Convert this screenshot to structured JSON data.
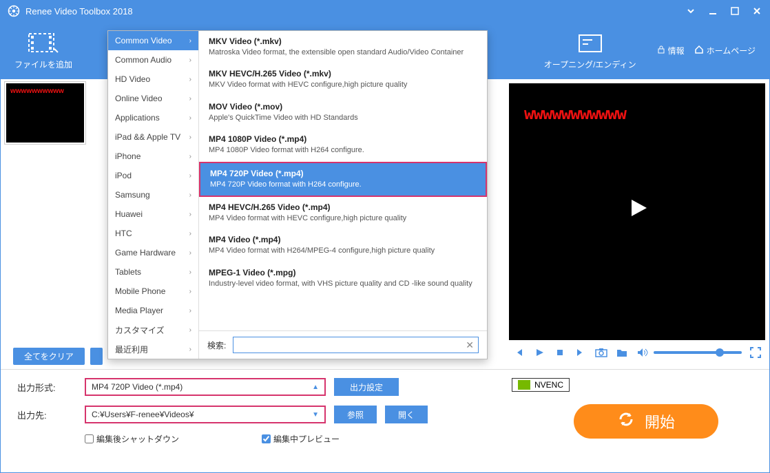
{
  "title": "Renee Video Toolbox 2018",
  "toolbar": {
    "add_file": "ファイルを追加",
    "opening_ending": "オープニング/エンディン",
    "info": "情報",
    "homepage": "ホームページ"
  },
  "preview": {
    "overlay_text": "wwwwwwwwwww",
    "thumb_text": "wwwwwwwwww"
  },
  "left_buttons": {
    "clear_all": "全てをクリア"
  },
  "dropdown": {
    "categories": [
      "Common Video",
      "Common Audio",
      "HD Video",
      "Online Video",
      "Applications",
      "iPad && Apple TV",
      "iPhone",
      "iPod",
      "Samsung",
      "Huawei",
      "HTC",
      "Game Hardware",
      "Tablets",
      "Mobile Phone",
      "Media Player",
      "カスタマイズ",
      "最近利用"
    ],
    "active_category": 0,
    "items": [
      {
        "title": "MKV Video (*.mkv)",
        "desc": "Matroska Video format, the extensible open standard Audio/Video Container"
      },
      {
        "title": "MKV HEVC/H.265 Video (*.mkv)",
        "desc": "MKV Video format with HEVC configure,high picture quality"
      },
      {
        "title": "MOV Video (*.mov)",
        "desc": "Apple's QuickTime Video with HD Standards"
      },
      {
        "title": "MP4 1080P Video (*.mp4)",
        "desc": "MP4 1080P Video format with H264 configure."
      },
      {
        "title": "MP4 720P Video (*.mp4)",
        "desc": "MP4 720P Video format with H264 configure."
      },
      {
        "title": "MP4 HEVC/H.265 Video (*.mp4)",
        "desc": "MP4 Video format with HEVC configure,high picture quality"
      },
      {
        "title": "MP4 Video (*.mp4)",
        "desc": "MP4 Video format with H264/MPEG-4 configure,high picture quality"
      },
      {
        "title": "MPEG-1 Video (*.mpg)",
        "desc": "Industry-level video format, with VHS picture quality and CD -like sound quality"
      }
    ],
    "selected_item": 4,
    "search_label": "検索:"
  },
  "bottom": {
    "format_label": "出力形式:",
    "format_value": "MP4 720P Video (*.mp4)",
    "settings_btn": "出力設定",
    "dest_label": "出力先:",
    "dest_value": "C:¥Users¥F-renee¥Videos¥",
    "browse_btn": "参照",
    "open_btn": "開く",
    "shutdown_label": "編集後シャットダウン",
    "preview_label": "編集中プレビュー",
    "nvenc": "NVENC",
    "start": "開始"
  }
}
